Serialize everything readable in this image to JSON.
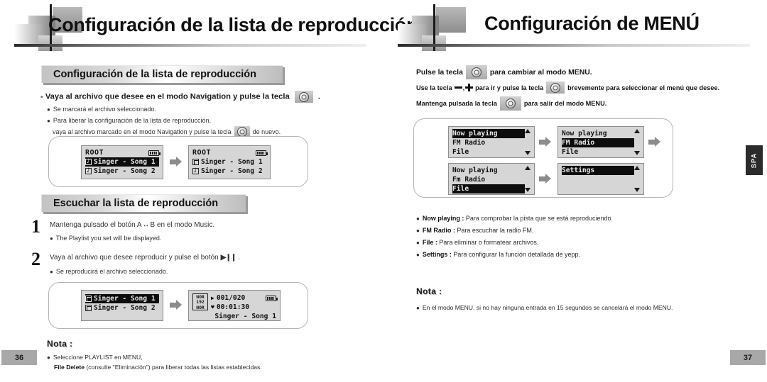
{
  "left_page": {
    "header_title": "Configuración de la lista de reproducción",
    "section1": {
      "heading": "Configuración de la lista de reproducción",
      "lead": "- Vaya al archivo que desee en el modo Navigation y pulse la tecla",
      "lead_tail": ".",
      "bullet1": "Se marcará el archivo seleccionado.",
      "bullet2": "Para liberar la configuración de la lista de reproducción,",
      "bullet2_line2_a": "vaya al archivo marcado en el modo Navigation y pulse la tecla",
      "bullet2_line2_b": "de nuevo."
    },
    "lcd_nav": {
      "left": {
        "title": "ROOT",
        "rows": [
          {
            "icon": "note-icon",
            "text": "Singer - Song 1",
            "highlighted": true
          },
          {
            "icon": "note-icon",
            "text": "Singer - Song 2",
            "highlighted": false
          }
        ]
      },
      "right": {
        "title": "ROOT",
        "rows": [
          {
            "icon": "doc-icon",
            "text": "Singer - Song 1",
            "highlighted": false
          },
          {
            "icon": "note-icon",
            "text": "Singer - Song 2",
            "highlighted": false
          }
        ]
      }
    },
    "section2": {
      "heading": "Escuchar la lista de reproducción",
      "steps": [
        {
          "number": "1",
          "text_a": "Mantenga pulsado el botón A",
          "text_mid": "↔",
          "text_b": "B en el modo Music.",
          "bullet": "The Playlist you set will be displayed."
        },
        {
          "number": "2",
          "text_a": "Vaya al archivo que desee reproducir y pulse el botón",
          "text_b": ".",
          "button_glyph": "▶❙❙",
          "bullet": "Se reproducirá el archivo seleccionado."
        }
      ]
    },
    "lcd_play": {
      "left": {
        "rows": [
          {
            "icon": "doc-icon",
            "text": "Singer - Song 1",
            "highlighted": true
          },
          {
            "icon": "doc-icon",
            "text": "Singer - Song 2",
            "highlighted": false
          }
        ]
      },
      "right": {
        "badge_top": "NOR",
        "badge_mid": "192",
        "badge_bot": "NOR",
        "play_symbol": "▶",
        "track_counter": "001/020",
        "heart_symbol": "♥",
        "elapsed_time": "00:01:30",
        "track_title": "Singer - Song 1"
      }
    },
    "nota": {
      "label": "Nota :",
      "bullet_a": "Seleccione PLAYLIST en MENU,",
      "bullet_b_bold": "File Delete",
      "bullet_b_rest": " (consulte \"Eliminación\") para liberar todas las listas establecidas."
    },
    "page_number": "36"
  },
  "right_page": {
    "header_title": "Configuración de MENÚ",
    "lines": {
      "line1_a": "Pulse la tecla",
      "line1_b": "para cambiar al modo MENU.",
      "line2_a": "Use la tecla",
      "line2_b": "para ir y pulse la tecla",
      "line2_c": "brevemente para seleccionar el menú que desee.",
      "line3_a": "Mantenga pulsada la tecla",
      "line3_b": "para salir del modo MENU."
    },
    "lcd_menus": [
      {
        "rows": [
          {
            "text": "Now playing",
            "highlighted": true
          },
          {
            "text": "FM Radio",
            "highlighted": false
          },
          {
            "text": "File",
            "highlighted": false
          }
        ]
      },
      {
        "rows": [
          {
            "text": "Now playing",
            "highlighted": false
          },
          {
            "text": "FM Radio",
            "highlighted": true
          },
          {
            "text": "File",
            "highlighted": false
          }
        ]
      },
      {
        "rows": [
          {
            "text": "Now playing",
            "highlighted": false
          },
          {
            "text": "Fm Radio",
            "highlighted": false
          },
          {
            "text": "File",
            "highlighted": true
          }
        ]
      },
      {
        "rows": [
          {
            "text": "Settings",
            "highlighted": true
          },
          {
            "text": "",
            "highlighted": false
          },
          {
            "text": "",
            "highlighted": false
          }
        ]
      }
    ],
    "descriptions": [
      {
        "term": "Now playing",
        "sep": " : ",
        "desc": "Para comprobar la pista que se está reproduciendo."
      },
      {
        "term": "FM Radio",
        "sep": " : ",
        "desc": "Para escuchar la radio FM."
      },
      {
        "term": "File",
        "sep": " : ",
        "desc": "Para eliminar o formatear archivos."
      },
      {
        "term": "Settings",
        "sep": " : ",
        "desc": "Para configurar la función detallada de yepp."
      }
    ],
    "nota": {
      "label": "Nota :",
      "bullet": "En el modo MENU, si no hay ninguna entrada en 15 segundos se cancelará el modo MENU."
    },
    "page_number": "37",
    "side_tab": "SPA"
  }
}
